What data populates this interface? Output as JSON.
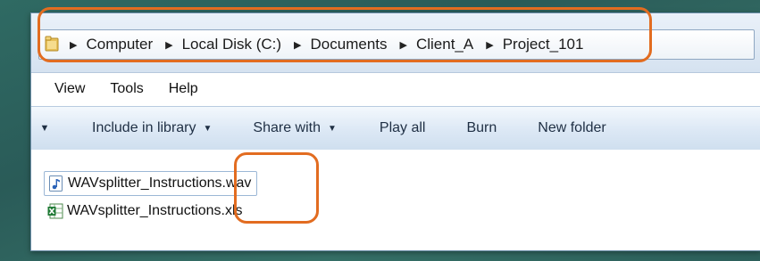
{
  "address_bar": {
    "breadcrumbs": [
      "Computer",
      "Local Disk (C:)",
      "Documents",
      "Client_A",
      "Project_101"
    ],
    "icon": "folder-icon"
  },
  "menu": {
    "items": [
      "View",
      "Tools",
      "Help"
    ]
  },
  "toolbar": {
    "include_label": "Include in library",
    "share_label": "Share with",
    "play_label": "Play all",
    "burn_label": "Burn",
    "newfolder_label": "New folder"
  },
  "files": [
    {
      "name": "WAVsplitter_Instructions.wav",
      "icon": "audio-file-icon",
      "selected": true
    },
    {
      "name": "WAVsplitter_Instructions.xls",
      "icon": "excel-file-icon",
      "selected": false
    }
  ],
  "colors": {
    "annotation": "#e26c20",
    "background": "#2f6a63",
    "toolbar_text": "#1f2f44"
  }
}
